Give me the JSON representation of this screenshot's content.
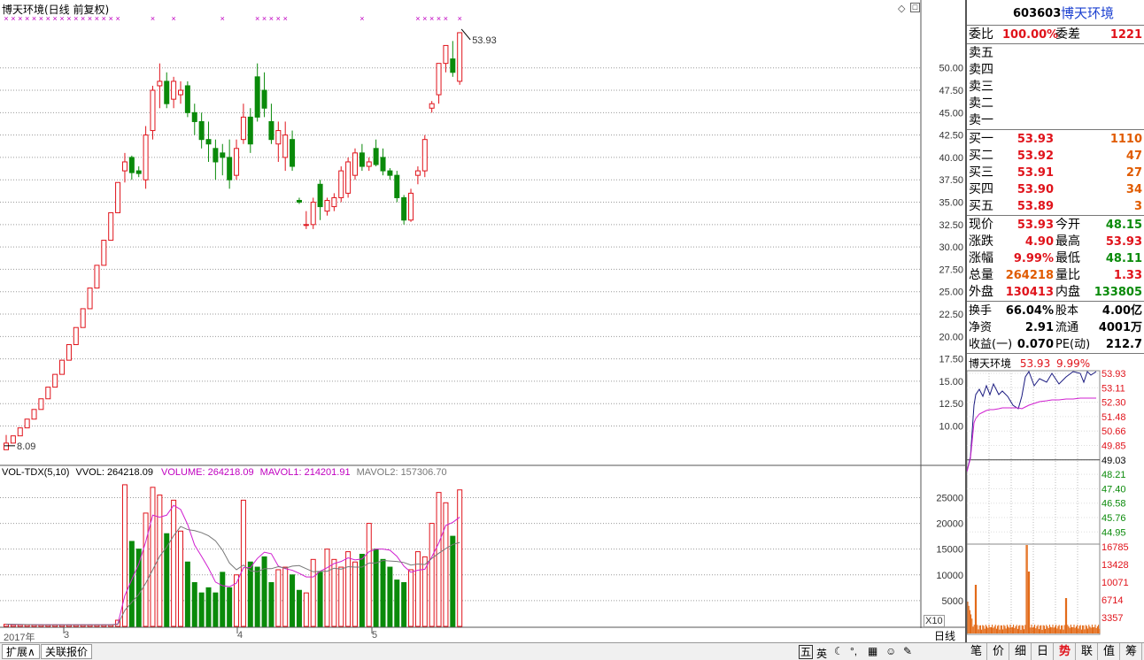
{
  "chart_title": "博天环境(日线 前复权)",
  "vol_header": {
    "name": "VOL-TDX(5,10)",
    "vvol": "VVOL: 264218.09",
    "volume": "VOLUME: 264218.09",
    "mavol1": "MAVOL1: 214201.91",
    "mavol2": "MAVOL2: 157306.70"
  },
  "price_annotations": {
    "high": "53.93",
    "low": "8.09"
  },
  "x_axis_labels": [
    "2017年",
    "3",
    "4",
    "5"
  ],
  "period_label": "日线",
  "x10_label": "X10",
  "chart_data": {
    "type": "candlestick",
    "title": "博天环境(日线 前复权)",
    "price_ylim": [
      6,
      56
    ],
    "price_ticks": [
      10,
      12.5,
      15,
      17.5,
      20,
      22.5,
      25,
      27.5,
      30,
      32.5,
      35,
      37.5,
      40,
      42.5,
      45,
      47.5,
      50
    ],
    "volume_ylim": [
      0,
      28000
    ],
    "volume_ticks": [
      5000,
      10000,
      15000,
      20000,
      25000
    ],
    "candles": [
      [
        7.35,
        9.0,
        7.35,
        8.09
      ],
      [
        8.09,
        8.9,
        8.09,
        8.9
      ],
      [
        8.9,
        9.79,
        8.9,
        9.79
      ],
      [
        9.79,
        10.77,
        9.79,
        10.77
      ],
      [
        10.77,
        11.85,
        10.77,
        11.85
      ],
      [
        11.85,
        13.04,
        11.85,
        13.04
      ],
      [
        13.04,
        14.34,
        13.04,
        14.34
      ],
      [
        14.34,
        15.77,
        14.34,
        15.77
      ],
      [
        15.77,
        17.35,
        15.77,
        17.35
      ],
      [
        17.35,
        19.09,
        17.35,
        19.09
      ],
      [
        19.09,
        21.0,
        19.09,
        21.0
      ],
      [
        21.0,
        23.1,
        21.0,
        23.1
      ],
      [
        23.1,
        25.41,
        23.1,
        25.41
      ],
      [
        25.41,
        27.95,
        25.41,
        27.95
      ],
      [
        27.95,
        30.75,
        27.95,
        30.75
      ],
      [
        30.75,
        33.82,
        30.75,
        33.82
      ],
      [
        33.82,
        37.2,
        33.82,
        37.2
      ],
      [
        38.5,
        40.5,
        37.2,
        39.5
      ],
      [
        40.0,
        40.2,
        37.5,
        38.3
      ],
      [
        38.5,
        39.0,
        37.8,
        38.2
      ],
      [
        37.5,
        43.5,
        36.5,
        42.5
      ],
      [
        43.0,
        48.0,
        42.0,
        47.5
      ],
      [
        48.0,
        50.5,
        45.5,
        48.5
      ],
      [
        48.5,
        49.5,
        45.5,
        46.0
      ],
      [
        46.5,
        49.0,
        45.5,
        48.5
      ],
      [
        47.0,
        48.5,
        46.0,
        47.5
      ],
      [
        48.0,
        48.5,
        44.5,
        45.0
      ],
      [
        45.0,
        46.0,
        42.5,
        44.0
      ],
      [
        44.0,
        45.0,
        41.0,
        42.0
      ],
      [
        42.0,
        44.0,
        39.5,
        41.5
      ],
      [
        41.0,
        42.0,
        37.5,
        39.5
      ],
      [
        40.5,
        41.5,
        38.0,
        40.0
      ],
      [
        40.0,
        42.0,
        36.5,
        37.5
      ],
      [
        38.0,
        42.0,
        37.5,
        41.0
      ],
      [
        42.0,
        46.0,
        41.5,
        44.5
      ],
      [
        44.5,
        45.5,
        40.5,
        41.5
      ],
      [
        49.0,
        50.5,
        44.0,
        44.5
      ],
      [
        47.5,
        49.5,
        44.5,
        45.5
      ],
      [
        44.0,
        46.0,
        41.5,
        42.0
      ],
      [
        41.5,
        44.0,
        39.5,
        43.0
      ],
      [
        40.0,
        44.0,
        38.5,
        42.5
      ],
      [
        42.0,
        43.0,
        38.5,
        39.0
      ],
      [
        35.2,
        35.5,
        34.8,
        35.0
      ],
      [
        32.5,
        34.0,
        32.0,
        32.5
      ],
      [
        32.5,
        35.5,
        32.0,
        35.0
      ],
      [
        37.0,
        37.5,
        33.0,
        34.5
      ],
      [
        34.0,
        35.5,
        33.5,
        35.2
      ],
      [
        34.5,
        36.0,
        34.0,
        35.5
      ],
      [
        35.5,
        39.0,
        35.0,
        38.5
      ],
      [
        36.0,
        40.0,
        35.5,
        39.5
      ],
      [
        38.0,
        41.0,
        37.5,
        40.5
      ],
      [
        40.5,
        41.5,
        38.5,
        39.0
      ],
      [
        39.0,
        40.0,
        38.5,
        39.5
      ],
      [
        41.0,
        42.0,
        39.0,
        39.2
      ],
      [
        40.0,
        41.0,
        38.0,
        38.5
      ],
      [
        38.5,
        38.8,
        37.5,
        38.0
      ],
      [
        38.0,
        38.5,
        35.0,
        35.5
      ],
      [
        35.5,
        35.8,
        32.5,
        33.0
      ],
      [
        33.0,
        36.5,
        32.8,
        36.0
      ],
      [
        38.0,
        39.0,
        37.0,
        38.5
      ],
      [
        38.5,
        42.5,
        37.8,
        42.0
      ],
      [
        45.5,
        46.3,
        45.0,
        46.0
      ],
      [
        47.0,
        50.5,
        46.0,
        50.5
      ],
      [
        50.5,
        52.5,
        49.5,
        52.5
      ],
      [
        51.0,
        53.0,
        49.0,
        49.5
      ],
      [
        48.5,
        53.93,
        48.11,
        53.93
      ]
    ],
    "volumes": [
      400,
      300,
      300,
      300,
      300,
      300,
      300,
      300,
      300,
      300,
      300,
      300,
      300,
      300,
      300,
      300,
      1200,
      27500,
      16500,
      15000,
      22000,
      27000,
      25500,
      18000,
      24500,
      18500,
      12500,
      8500,
      6500,
      7500,
      6500,
      10500,
      7500,
      10000,
      24500,
      12500,
      11500,
      13500,
      8500,
      11000,
      11500,
      10000,
      7000,
      6500,
      13000,
      10500,
      15000,
      13000,
      11500,
      14500,
      12500,
      14000,
      20000,
      15000,
      13000,
      11500,
      9000,
      8500,
      11000,
      14500,
      13500,
      20000,
      26000,
      24000,
      17500,
      26500
    ],
    "mavol1": [
      400,
      380,
      360,
      340,
      320,
      300,
      300,
      300,
      300,
      300,
      300,
      300,
      300,
      300,
      300,
      300,
      480,
      5960,
      9120,
      12100,
      16440,
      21600,
      21200,
      21600,
      23500,
      22700,
      19800,
      15800,
      13600,
      11300,
      8600,
      7900,
      7700,
      8400,
      11400,
      11400,
      13200,
      14400,
      14100,
      11700,
      11200,
      10900,
      10300,
      9600,
      9600,
      10700,
      11400,
      12200,
      12600,
      13300,
      12900,
      13100,
      14500,
      15000,
      15000,
      14800,
      13600,
      11700,
      10500,
      10900,
      11100,
      13500,
      16200,
      19600,
      20200,
      21200
    ],
    "mavol2": [
      400,
      380,
      360,
      340,
      320,
      300,
      300,
      300,
      300,
      300,
      300,
      300,
      300,
      300,
      300,
      300,
      380,
      3100,
      4700,
      6200,
      8400,
      11000,
      13600,
      15400,
      17600,
      19400,
      18800,
      18600,
      18200,
      17600,
      16600,
      14800,
      12300,
      11000,
      11900,
      10800,
      10600,
      11200,
      11200,
      11600,
      11300,
      11700,
      11800,
      11200,
      10600,
      10700,
      10700,
      11300,
      11100,
      11600,
      11500,
      11500,
      12300,
      12300,
      12800,
      12700,
      12600,
      12400,
      11900,
      12100,
      12000,
      13200,
      14200,
      15100,
      15900,
      16300
    ]
  },
  "quote": {
    "code": "603603",
    "name": "博天环境",
    "weibi_label": "委比",
    "weibi_value": "100.00%",
    "weicha_label": "委差",
    "weicha_value": "1221",
    "sell": [
      {
        "label": "卖五",
        "price": "",
        "vol": ""
      },
      {
        "label": "卖四",
        "price": "",
        "vol": ""
      },
      {
        "label": "卖三",
        "price": "",
        "vol": ""
      },
      {
        "label": "卖二",
        "price": "",
        "vol": ""
      },
      {
        "label": "卖一",
        "price": "",
        "vol": ""
      }
    ],
    "buy": [
      {
        "label": "买一",
        "price": "53.93",
        "vol": "1110"
      },
      {
        "label": "买二",
        "price": "53.92",
        "vol": "47"
      },
      {
        "label": "买三",
        "price": "53.91",
        "vol": "27"
      },
      {
        "label": "买四",
        "price": "53.90",
        "vol": "34"
      },
      {
        "label": "买五",
        "price": "53.89",
        "vol": "3"
      }
    ],
    "stats1": [
      {
        "l1": "现价",
        "v1": "53.93",
        "l2": "今开",
        "v2": "48.15",
        "c1": "red",
        "c2": "green"
      },
      {
        "l1": "涨跌",
        "v1": "4.90",
        "l2": "最高",
        "v2": "53.93",
        "c1": "red",
        "c2": "red"
      },
      {
        "l1": "涨幅",
        "v1": "9.99%",
        "l2": "最低",
        "v2": "48.11",
        "c1": "red",
        "c2": "green"
      },
      {
        "l1": "总量",
        "v1": "264218",
        "l2": "量比",
        "v2": "1.33",
        "c1": "orange",
        "c2": "red"
      },
      {
        "l1": "外盘",
        "v1": "130413",
        "l2": "内盘",
        "v2": "133805",
        "c1": "red",
        "c2": "green"
      }
    ],
    "stats2": [
      {
        "l1": "换手",
        "v1": "66.04%",
        "l2": "股本",
        "v2": "4.00亿"
      },
      {
        "l1": "净资",
        "v1": "2.91",
        "l2": "流通",
        "v2": "4001万"
      },
      {
        "l1": "收益(一)",
        "v1": "0.070",
        "l2": "PE(动)",
        "v2": "212.7"
      }
    ]
  },
  "intraday": {
    "title": "博天环境",
    "price": "53.93",
    "pct": "9.99%",
    "price_labels": [
      "53.93",
      "53.11",
      "52.30",
      "51.48",
      "50.66",
      "49.85",
      "49.03",
      "48.21",
      "47.40",
      "46.58",
      "45.76",
      "44.95"
    ],
    "vol_labels": [
      "16785",
      "13428",
      "10071",
      "6714",
      "3357"
    ]
  },
  "bottom_tabs": [
    "扩展∧",
    "关联报价"
  ],
  "right_tabs": [
    "笔",
    "价",
    "细",
    "日",
    "势",
    "联",
    "值",
    "筹"
  ],
  "tray_icons": [
    "五",
    "英"
  ]
}
